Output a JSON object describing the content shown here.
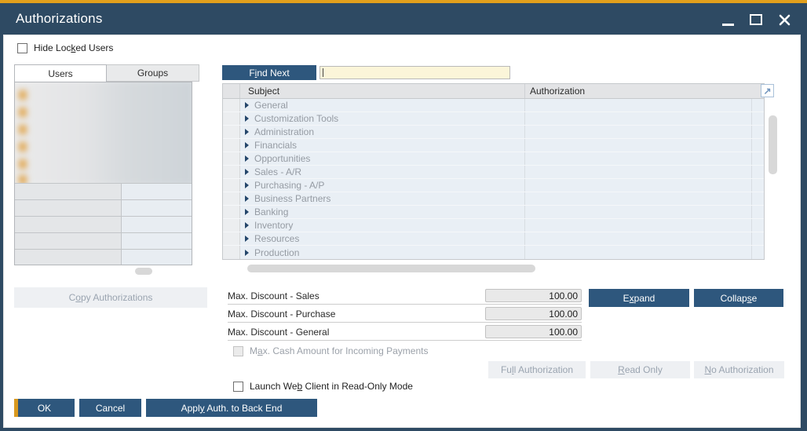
{
  "window": {
    "title": "Authorizations",
    "controls": {
      "minimize": "minimize",
      "maximize": "maximize",
      "close": "close"
    }
  },
  "header": {
    "hide_locked_users": {
      "pre": "Hide Loc",
      "accel": "k",
      "post": "ed Users",
      "checked": false
    }
  },
  "tabs": [
    {
      "label": "Users",
      "active": true
    },
    {
      "label": "Groups",
      "active": false
    }
  ],
  "left_panel": {
    "note": "user list redacted/blurred",
    "copy_authorizations": {
      "pre": "C",
      "accel": "o",
      "post": "py Authorizations",
      "disabled": true
    }
  },
  "search": {
    "find_next": {
      "pre": "F",
      "accel": "i",
      "post": "nd Next"
    },
    "value": ""
  },
  "table": {
    "columns": [
      "Subject",
      "Authorization"
    ],
    "rows": [
      {
        "label": "General"
      },
      {
        "label": "Customization Tools"
      },
      {
        "label": "Administration"
      },
      {
        "label": "Financials"
      },
      {
        "label": "Opportunities"
      },
      {
        "label": "Sales - A/R"
      },
      {
        "label": "Purchasing - A/P"
      },
      {
        "label": "Business Partners"
      },
      {
        "label": "Banking"
      },
      {
        "label": "Inventory"
      },
      {
        "label": "Resources"
      },
      {
        "label": "Production"
      }
    ],
    "corner_icon": "↗"
  },
  "form": {
    "rows": [
      {
        "label": "Max. Discount - Sales",
        "value": "100.00"
      },
      {
        "label": "Max. Discount - Purchase",
        "value": "100.00"
      },
      {
        "label": "Max. Discount - General",
        "value": "100.00"
      }
    ],
    "max_cash": {
      "pre": "M",
      "accel": "a",
      "post": "x. Cash Amount for Incoming Payments",
      "checked": false,
      "disabled": true
    },
    "launch_web": {
      "pre": "Launch We",
      "accel": "b",
      "post": " Client in Read-Only Mode",
      "checked": false
    }
  },
  "buttons": {
    "expand": {
      "pre": "E",
      "accel": "x",
      "post": "pand"
    },
    "collapse": {
      "pre": "Collap",
      "accel": "s",
      "post": "e"
    },
    "full_authorization": {
      "pre": "Fu",
      "accel": "l",
      "post": "l Authorization",
      "disabled": true
    },
    "read_only": {
      "pre": "",
      "accel": "R",
      "post": "ead Only",
      "disabled": true
    },
    "no_authorization": {
      "pre": "",
      "accel": "N",
      "post": "o Authorization",
      "disabled": true
    },
    "ok": {
      "pre": "OK",
      "accel": "",
      "post": ""
    },
    "cancel": {
      "pre": "Cancel",
      "accel": "",
      "post": ""
    },
    "apply": {
      "pre": "Appl",
      "accel": "y",
      "post": " Auth. to Back End"
    }
  },
  "colors": {
    "accent_gold": "#e2a01c",
    "frame_blue": "#2e4a63",
    "button_blue": "#2e577d",
    "input_cream": "#fbf5d9",
    "row_blue": "#e9eff5",
    "disabled_button_bg": "#eef0f3",
    "disabled_text": "#9aa4b0",
    "tree_text": "#959ba3",
    "ok_default_bar": "#d9991f"
  }
}
